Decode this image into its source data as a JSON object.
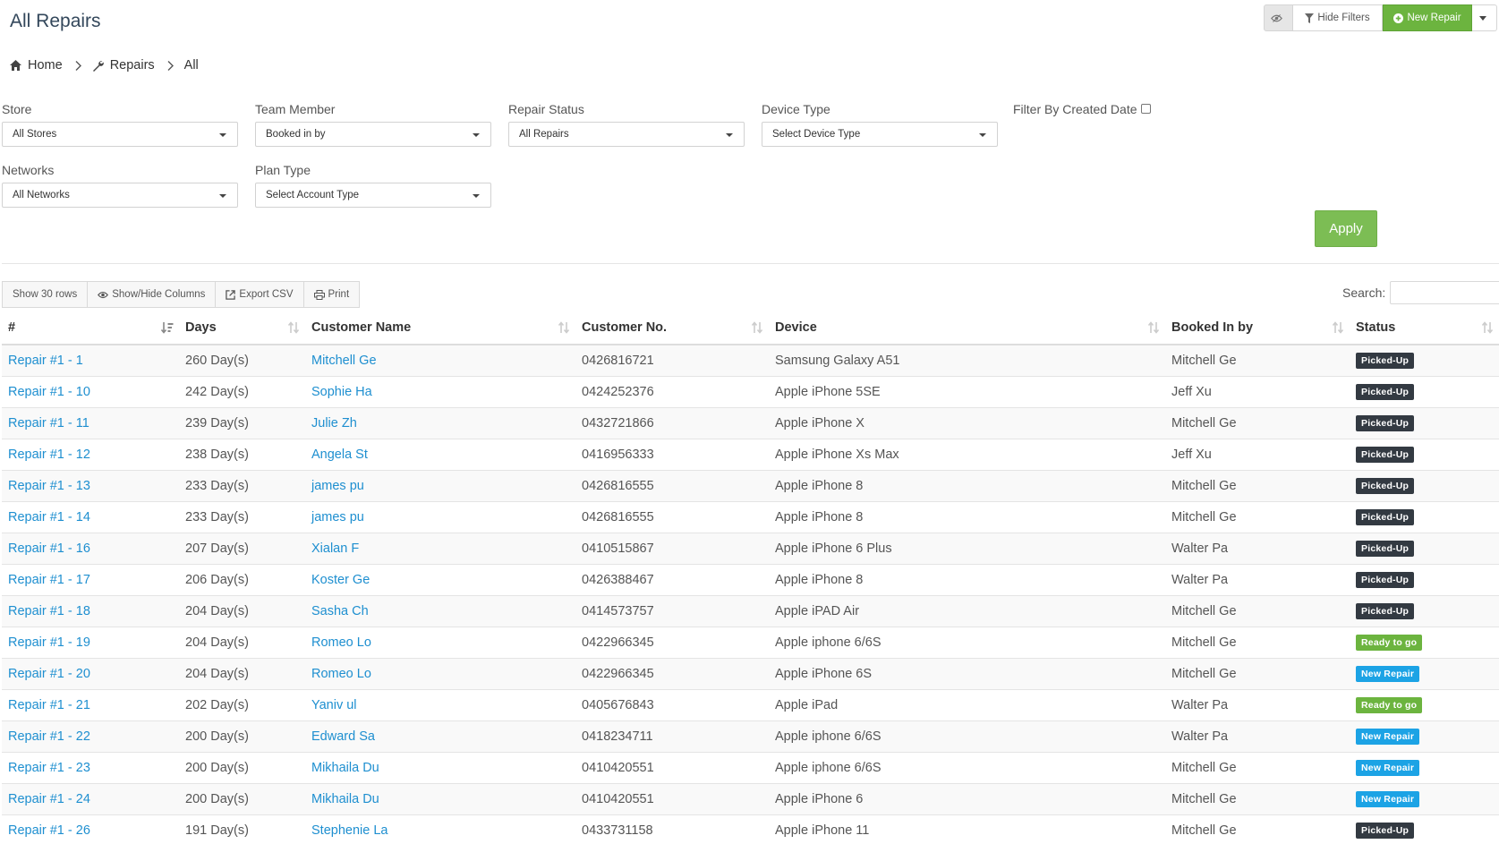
{
  "header": {
    "title": "All Repairs",
    "hide_filters_label": "Hide Filters",
    "new_repair_label": "New Repair"
  },
  "breadcrumb": {
    "home": "Home",
    "repairs": "Repairs",
    "current": "All"
  },
  "filters": {
    "store": {
      "label": "Store",
      "value": "All Stores"
    },
    "team_member": {
      "label": "Team Member",
      "value": "Booked in by"
    },
    "repair_status": {
      "label": "Repair Status",
      "value": "All Repairs"
    },
    "device_type": {
      "label": "Device Type",
      "value": "Select Device Type"
    },
    "created_date": {
      "label": "Filter By Created Date"
    },
    "networks": {
      "label": "Networks",
      "value": "All Networks"
    },
    "plan_type": {
      "label": "Plan Type",
      "value": "Select Account Type"
    },
    "apply_label": "Apply"
  },
  "toolbar": {
    "show_rows": "Show 30 rows",
    "show_hide_columns": "Show/Hide Columns",
    "export_csv": "Export CSV",
    "print": "Print",
    "search_label": "Search:"
  },
  "table": {
    "columns": [
      "#",
      "Days",
      "Customer Name",
      "Customer No.",
      "Device",
      "Booked In by",
      "Status"
    ],
    "rows": [
      {
        "id": "Repair #1 - 1",
        "days": "260 Day(s)",
        "customer": "Mitchell Ge",
        "phone": "0426816721",
        "device": "Samsung Galaxy A51",
        "booked_by": "Mitchell Ge",
        "status": "Picked-Up"
      },
      {
        "id": "Repair #1 - 10",
        "days": "242 Day(s)",
        "customer": "Sophie Ha",
        "phone": "0424252376",
        "device": "Apple iPhone 5SE",
        "booked_by": "Jeff Xu",
        "status": "Picked-Up"
      },
      {
        "id": "Repair #1 - 11",
        "days": "239 Day(s)",
        "customer": "Julie Zh",
        "phone": "0432721866",
        "device": "Apple iPhone X",
        "booked_by": "Mitchell Ge",
        "status": "Picked-Up"
      },
      {
        "id": "Repair #1 - 12",
        "days": "238 Day(s)",
        "customer": "Angela St",
        "phone": "0416956333",
        "device": "Apple iPhone Xs Max",
        "booked_by": "Jeff Xu",
        "status": "Picked-Up"
      },
      {
        "id": "Repair #1 - 13",
        "days": "233 Day(s)",
        "customer": "james pu",
        "phone": "0426816555",
        "device": "Apple iPhone 8",
        "booked_by": "Mitchell Ge",
        "status": "Picked-Up"
      },
      {
        "id": "Repair #1 - 14",
        "days": "233 Day(s)",
        "customer": "james pu",
        "phone": "0426816555",
        "device": "Apple iPhone 8",
        "booked_by": "Mitchell Ge",
        "status": "Picked-Up"
      },
      {
        "id": "Repair #1 - 16",
        "days": "207 Day(s)",
        "customer": "Xialan F",
        "phone": "0410515867",
        "device": "Apple iPhone 6 Plus",
        "booked_by": "Walter Pa",
        "status": "Picked-Up"
      },
      {
        "id": "Repair #1 - 17",
        "days": "206 Day(s)",
        "customer": "Koster Ge",
        "phone": "0426388467",
        "device": "Apple iPhone 8",
        "booked_by": "Walter Pa",
        "status": "Picked-Up"
      },
      {
        "id": "Repair #1 - 18",
        "days": "204 Day(s)",
        "customer": "Sasha Ch",
        "phone": "0414573757",
        "device": "Apple iPAD Air",
        "booked_by": "Mitchell Ge",
        "status": "Picked-Up"
      },
      {
        "id": "Repair #1 - 19",
        "days": "204 Day(s)",
        "customer": "Romeo Lo",
        "phone": "0422966345",
        "device": "Apple iphone 6/6S",
        "booked_by": "Mitchell Ge",
        "status": "Ready to go"
      },
      {
        "id": "Repair #1 - 20",
        "days": "204 Day(s)",
        "customer": "Romeo Lo",
        "phone": "0422966345",
        "device": "Apple iPhone 6S",
        "booked_by": "Mitchell Ge",
        "status": "New Repair"
      },
      {
        "id": "Repair #1 - 21",
        "days": "202 Day(s)",
        "customer": "Yaniv ul",
        "phone": "0405676843",
        "device": "Apple iPad",
        "booked_by": "Walter Pa",
        "status": "Ready to go"
      },
      {
        "id": "Repair #1 - 22",
        "days": "200 Day(s)",
        "customer": "Edward Sa",
        "phone": "0418234711",
        "device": "Apple iphone 6/6S",
        "booked_by": "Walter Pa",
        "status": "New Repair"
      },
      {
        "id": "Repair #1 - 23",
        "days": "200 Day(s)",
        "customer": "Mikhaila Du",
        "phone": "0410420551",
        "device": "Apple iphone 6/6S",
        "booked_by": "Mitchell Ge",
        "status": "New Repair"
      },
      {
        "id": "Repair #1 - 24",
        "days": "200 Day(s)",
        "customer": "Mikhaila Du",
        "phone": "0410420551",
        "device": "Apple iPhone 6",
        "booked_by": "Mitchell Ge",
        "status": "New Repair"
      },
      {
        "id": "Repair #1 - 26",
        "days": "191 Day(s)",
        "customer": "Stephenie La",
        "phone": "0433731158",
        "device": "Apple iPhone 11",
        "booked_by": "Mitchell Ge",
        "status": "Picked-Up"
      }
    ]
  },
  "status_colors": {
    "Picked-Up": "#333a42",
    "Ready to go": "#6cb43f",
    "New Repair": "#1ca3e5"
  },
  "colors": {
    "link": "#1e8fd0",
    "accent": "#6cb43f"
  }
}
